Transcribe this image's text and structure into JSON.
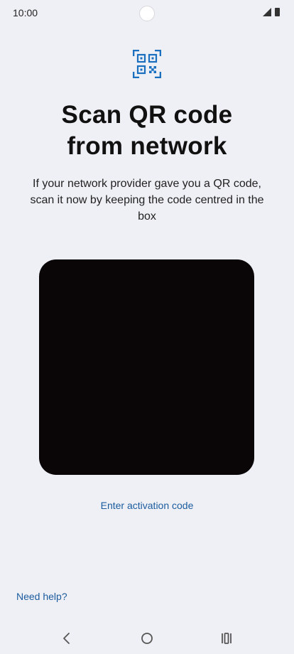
{
  "status_bar": {
    "time": "10:00"
  },
  "header": {
    "icon": "qr-scan-icon",
    "title": "Scan QR code\nfrom network",
    "description": "If your network provider gave you a QR code, scan it now by keeping the code centred in the box"
  },
  "scanner": {
    "viewfinder_color": "#0a0608"
  },
  "actions": {
    "activation_link": "Enter activation code",
    "help_link": "Need help?"
  },
  "nav_bar": {
    "back_icon": "back-chevron-icon",
    "home_icon": "home-circle-icon",
    "recents_icon": "recents-icon"
  },
  "colors": {
    "background": "#eff0f5",
    "accent": "#1b5c9f",
    "icon_blue": "#1a6fbe"
  }
}
